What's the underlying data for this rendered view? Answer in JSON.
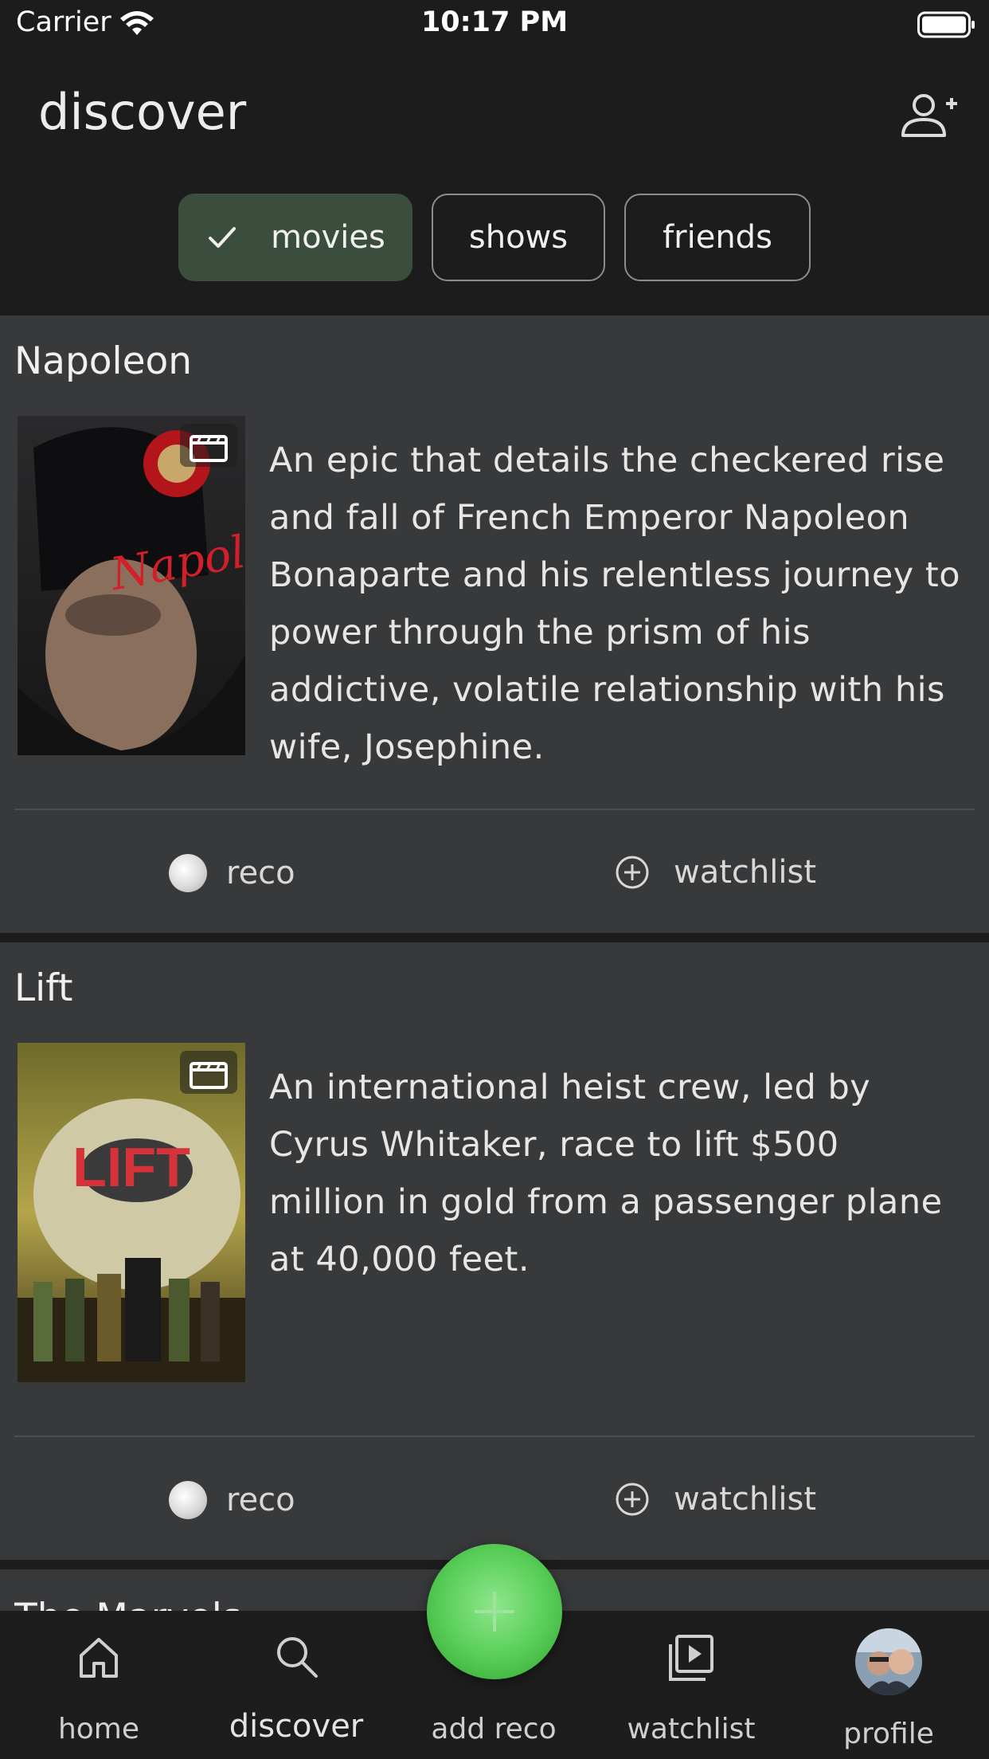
{
  "status": {
    "carrier": "Carrier",
    "time": "10:17 PM"
  },
  "header": {
    "title": "discover",
    "add_friend_icon": "person-add-icon"
  },
  "filters": [
    {
      "label": "movies",
      "selected": true
    },
    {
      "label": "shows",
      "selected": false
    },
    {
      "label": "friends",
      "selected": false
    }
  ],
  "cards": [
    {
      "title": "Napoleon",
      "description_lines": [
        "An epic that details the checkered rise",
        "and fall of French Emperor Napoleon",
        "Bonaparte and his relentless journey to",
        "power through the prism of his",
        "addictive, volatile relationship with his",
        "wife, Josephine."
      ],
      "poster_text": "Napoleon",
      "reco_label": "reco",
      "watchlist_label": "watchlist"
    },
    {
      "title": "Lift",
      "description_lines": [
        "An international heist crew, led by",
        "Cyrus Whitaker, race to lift $500",
        "million in gold from a passenger plane",
        "at 40,000 feet."
      ],
      "poster_text": "LIFT",
      "reco_label": "reco",
      "watchlist_label": "watchlist"
    }
  ],
  "peek_title": "The Marvels",
  "tabbar": {
    "home": "home",
    "discover": "discover",
    "add_reco": "add reco",
    "watchlist": "watchlist",
    "profile": "profile"
  },
  "colors": {
    "accent_green": "#5bd05a",
    "chip_selected": "#3b4e3d",
    "card_bg": "#38393a",
    "app_bg": "#1b1c1b"
  }
}
